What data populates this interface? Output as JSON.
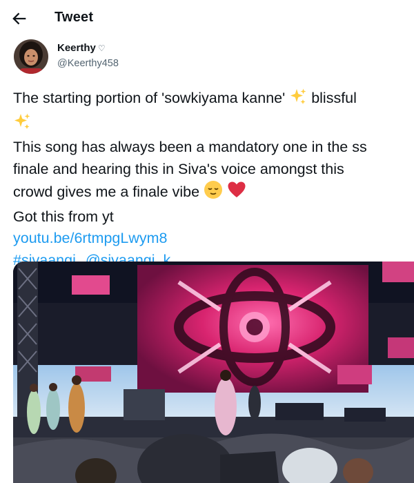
{
  "header": {
    "title": "Tweet",
    "back_icon": "arrow-left-icon"
  },
  "author": {
    "name": "Keerthy",
    "badge": "♡",
    "handle": "@Keerthy458"
  },
  "tweet": {
    "line1_text": "The starting portion of 'sowkiyama kanne'",
    "line1_after": "blissful",
    "line3": "This song has always been a mandatory one in the ss",
    "line4": "finale and hearing this in Siva's voice amongst this",
    "line5": "crowd gives me a finale vibe",
    "line6": "Got this from yt",
    "link": "youtu.be/6rtmpgLwym8",
    "hashtag": "#sivaangi",
    "mention": "@sivaangi_k",
    "emojis": [
      "sparkles-icon",
      "sparkles-icon",
      "relieved-face-icon",
      "red-heart-icon"
    ]
  },
  "media": {
    "kind": "photo",
    "subject": "concert-stage-photo"
  },
  "colors": {
    "link": "#1d9bf0",
    "text": "#0f1419",
    "secondary": "#536471"
  }
}
